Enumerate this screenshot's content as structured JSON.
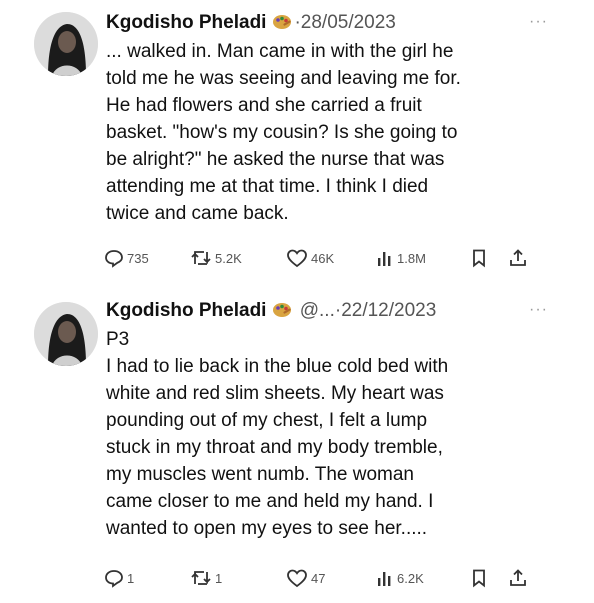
{
  "tweets": [
    {
      "author": "Kgodisho Pheladi",
      "handle": "",
      "date": "28/05/2023",
      "more": "···",
      "text": "... walked in. Man came in with the girl he\ntold me he was seeing and leaving me for.\nHe had flowers and she carried a fruit\nbasket. \"how's my cousin? Is she going to\nbe alright?\" he asked the nurse that was\nattending me at that time. I think I died\ntwice and came back.",
      "replies": "735",
      "retweets": "5.2K",
      "likes": "46K",
      "views": "1.8M"
    },
    {
      "author": "Kgodisho Pheladi",
      "handle": "@...",
      "date": "22/12/2023",
      "more": "···",
      "text": "P3\nI had to lie back in the blue cold bed with\nwhite and red slim sheets. My heart was\npounding out of my chest, I felt a lump\nstuck in my throat and my body tremble,\nmy muscles went numb. The woman\ncame closer to me and held my hand. I\nwanted to open my eyes to see her.....",
      "replies": "1",
      "retweets": "1",
      "likes": "47",
      "views": "6.2K"
    }
  ],
  "date_separator": "·",
  "icons": {
    "reply": "reply-icon",
    "retweet": "retweet-icon",
    "like": "heart-icon",
    "views": "views-icon",
    "bookmark": "bookmark-icon",
    "share": "share-icon",
    "badge": "painting-emoji-icon"
  },
  "colors": {
    "text": "#111111",
    "muted": "#555555",
    "background": "#ffffff"
  }
}
